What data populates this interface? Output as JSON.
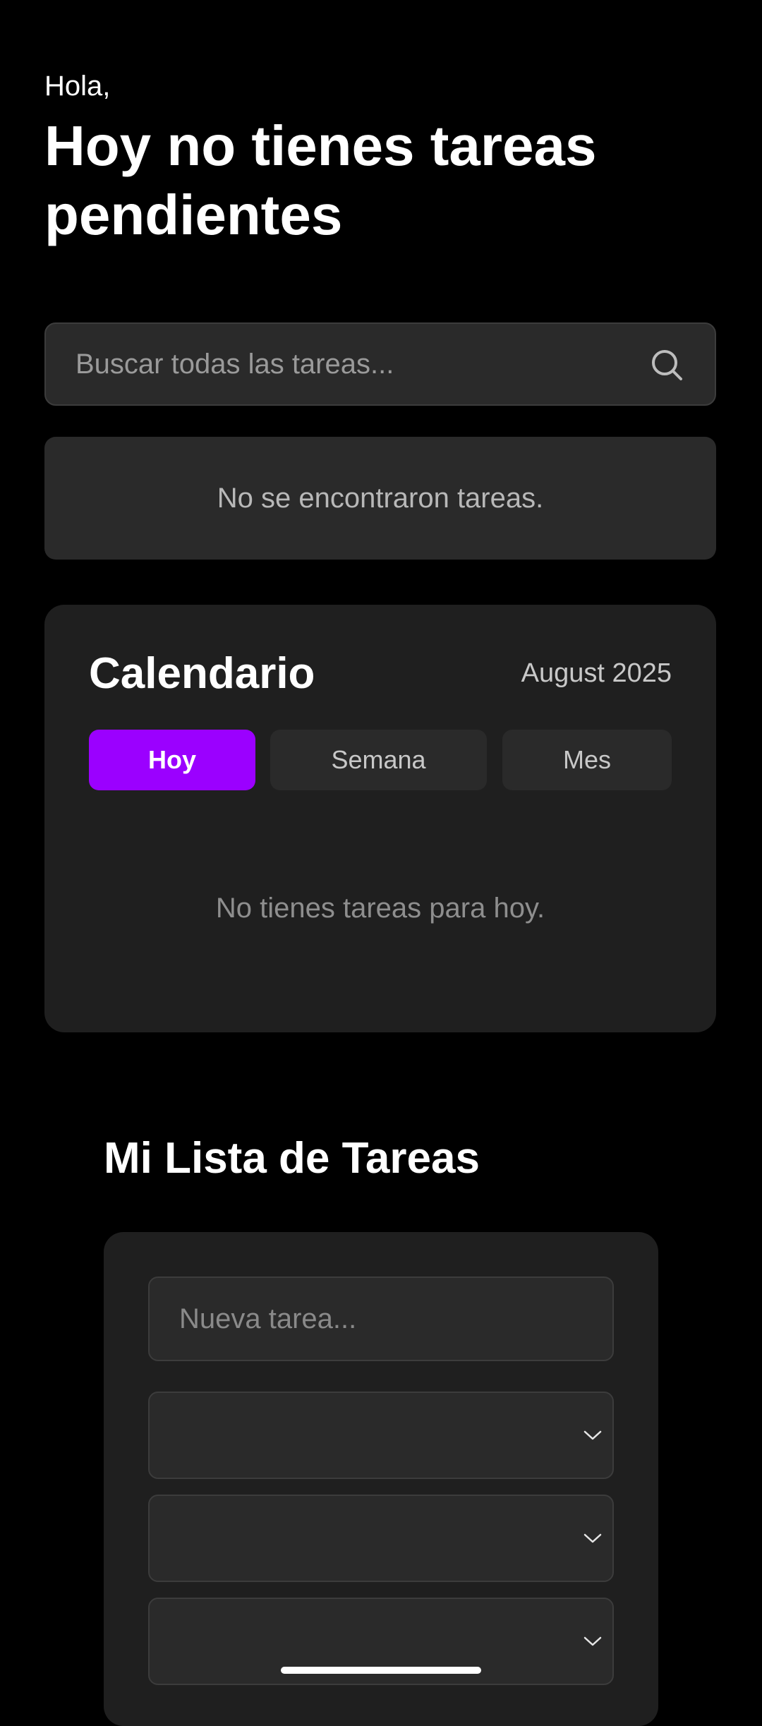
{
  "header": {
    "greeting": "Hola,",
    "headline": "Hoy no tienes tareas pendientes"
  },
  "search": {
    "placeholder": "Buscar todas las tareas...",
    "value": "",
    "icon": "search-icon",
    "no_results": "No se encontraron tareas."
  },
  "calendar": {
    "title": "Calendario",
    "month": "August 2025",
    "tabs": [
      {
        "label": "Hoy",
        "active": true
      },
      {
        "label": "Semana",
        "active": false
      },
      {
        "label": "Mes",
        "active": false
      }
    ],
    "empty_message": "No tienes tareas para hoy.",
    "accent_color": "#9b00ff"
  },
  "task_list": {
    "title": "Mi Lista de Tareas",
    "new_task_placeholder": "Nueva tarea...",
    "selects": [
      {
        "value": "",
        "icon": "chevron-down-icon"
      },
      {
        "value": "",
        "icon": "chevron-down-icon"
      },
      {
        "value": "",
        "icon": "chevron-down-icon"
      }
    ]
  }
}
